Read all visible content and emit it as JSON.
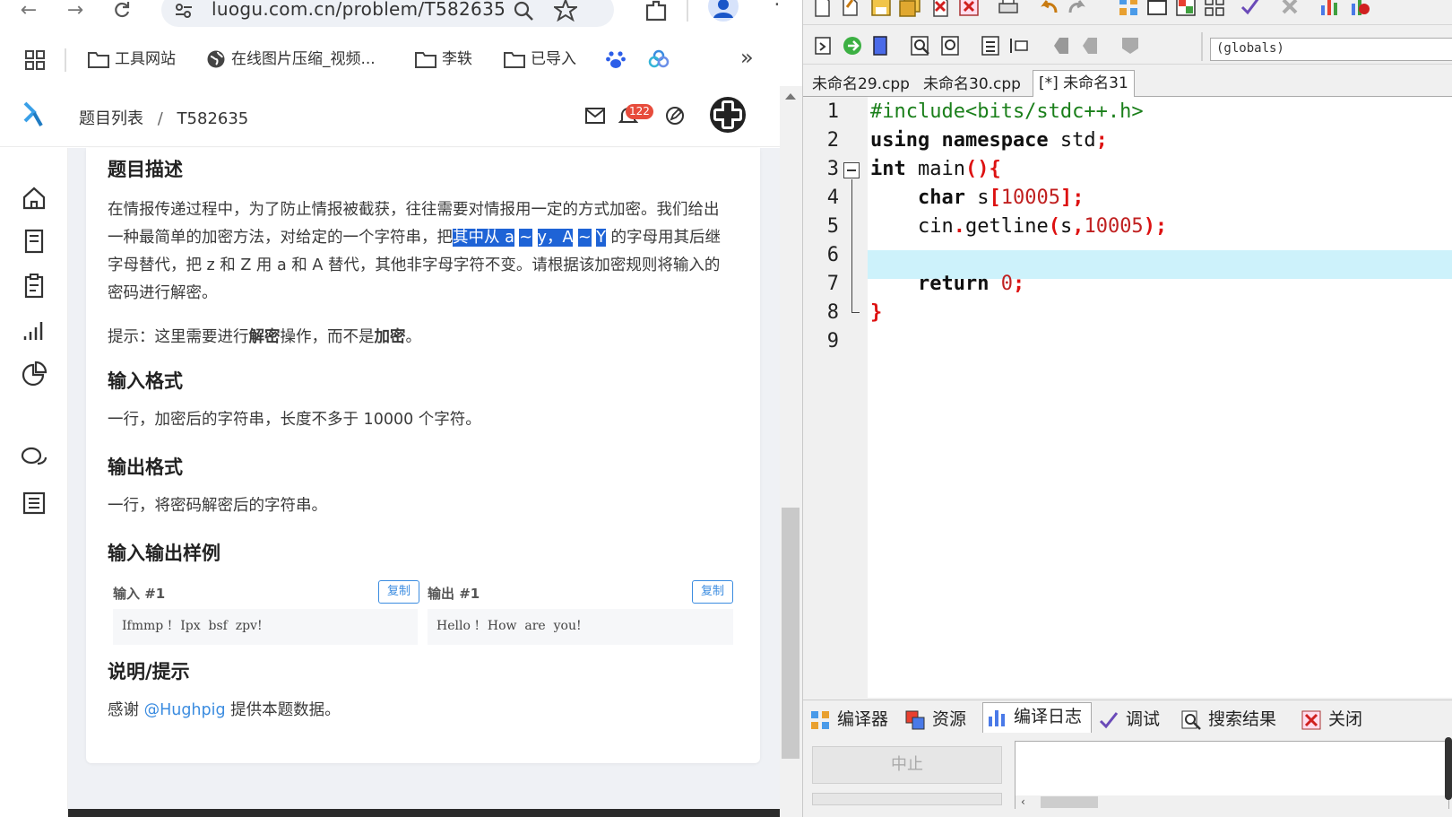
{
  "browser": {
    "url": "luogu.com.cn/problem/T582635",
    "bookmarks": [
      {
        "label": "工具网站"
      },
      {
        "label": "在线图片压缩_视频..."
      },
      {
        "label": "李轶"
      },
      {
        "label": "已导入"
      }
    ],
    "more_icon": "»"
  },
  "site": {
    "breadcrumb": {
      "root": "题目列表",
      "sep": "/",
      "current": "T582635"
    },
    "notification_count": "122"
  },
  "problem": {
    "description_title": "题目描述",
    "description_pre": "在情报传递过程中，为了防止情报被截获，往往需要对情报用一定的方式加密。我们给出一种最简单的加密方法，对给定的一个字符串，把",
    "description_highlight_1": "其中从 a",
    "description_highlight_2": "~",
    "description_highlight_3": "y，A",
    "description_highlight_4": "~",
    "description_highlight_5": "Y",
    "description_post": " 的字母用其后继字母替代，把 z 和 Z 用 a 和 A 替代，其他非字母字符不变。请根据该加密规则将输入的密码进行解密。",
    "hint_pre": "提示：这里需要进行",
    "hint_bold_1": "解密",
    "hint_mid": "操作，而不是",
    "hint_bold_2": "加密",
    "hint_post": "。",
    "input_title": "输入格式",
    "input_text": "一行，加密后的字符串，长度不多于 10000 个字符。",
    "output_title": "输出格式",
    "output_text": "一行，将密码解密后的字符串。",
    "samples_title": "输入输出样例",
    "sample_input_label": "输入 #1",
    "sample_output_label": "输出 #1",
    "copy_label": "复制",
    "sample_input": "Ifmmp !  Ipx  bsf  zpv!",
    "sample_output": "Hello !  How  are  you!",
    "notes_title": "说明/提示",
    "notes_pre": "感谢 ",
    "notes_link": "@Hughpig",
    "notes_post": " 提供本题数据。"
  },
  "ide": {
    "scope": "(globals)",
    "tabs": [
      "未命名29.cpp",
      "未命名30.cpp",
      "[*] 未命名31"
    ],
    "line_numbers": [
      "1",
      "2",
      "3",
      "4",
      "5",
      "6",
      "7",
      "8",
      "9"
    ],
    "code": {
      "l1": "#include<bits/stdc++.h>",
      "l2_kw": "using namespace",
      "l2_rest": " std",
      "l3_kw": "int",
      "l3_rest": " main",
      "l4_kw": "char",
      "l4_a": " s",
      "l4_num": "10005",
      "l5_a": "cin",
      "l5_b": "getline",
      "l5_c": "s",
      "l5_num": "10005",
      "l7_kw": "return",
      "l7_num": "0"
    },
    "bottom_tabs": [
      "编译器",
      "资源",
      "编译日志",
      "调试",
      "搜索结果",
      "关闭"
    ],
    "stop_label": "中止"
  },
  "colors": {
    "highlight": "#1e63d6",
    "link": "#3b8ce0",
    "current_line": "#cdf2fb",
    "code_number": "#c02020",
    "code_symbol": "#dd1111"
  }
}
